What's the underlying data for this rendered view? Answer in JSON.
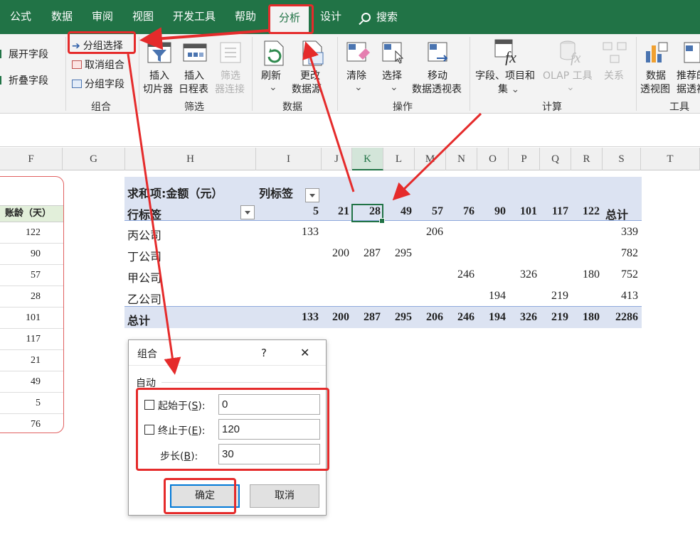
{
  "tabs": [
    {
      "label": "公式"
    },
    {
      "label": "数据"
    },
    {
      "label": "审阅"
    },
    {
      "label": "视图"
    },
    {
      "label": "开发工具"
    },
    {
      "label": "帮助"
    },
    {
      "label": "分析"
    },
    {
      "label": "设计"
    }
  ],
  "search": {
    "label": "搜索"
  },
  "ribbon": {
    "active_field": {
      "expand": "展开字段",
      "collapse": "折叠字段"
    },
    "group": {
      "group_selection": "分组选择",
      "ungroup": "取消组合",
      "group_field": "分组字段",
      "name": "组合"
    },
    "filter": {
      "slicer_1": "插入",
      "slicer_2": "切片器",
      "timeline_1": "插入",
      "timeline_2": "日程表",
      "conn_1": "筛选",
      "conn_2": "器连接",
      "name": "筛选"
    },
    "data": {
      "refresh": "刷新",
      "change_1": "更改",
      "change_2": "数据源",
      "name": "数据"
    },
    "actions": {
      "clear": "清除",
      "select": "选择",
      "move_1": "移动",
      "move_2": "数据透视表",
      "name": "操作"
    },
    "calc": {
      "fields_1": "字段、项目和",
      "fields_2": "集",
      "olap": "OLAP 工具",
      "relations": "关系",
      "name": "计算"
    },
    "tools": {
      "chart_1": "数据",
      "chart_2": "透视图",
      "rec_1": "推荐的",
      "rec_2": "据透视",
      "name": "工具"
    }
  },
  "columns": [
    "F",
    "G",
    "H",
    "I",
    "J",
    "K",
    "L",
    "M",
    "N",
    "O",
    "P",
    "Q",
    "R",
    "S",
    "T"
  ],
  "source_table": {
    "header": "账龄（天）",
    "values": [
      "122",
      "90",
      "57",
      "28",
      "101",
      "117",
      "21",
      "49",
      "5",
      "76"
    ]
  },
  "pivot": {
    "title": "求和项:金额（元）",
    "col_label": "列标签",
    "row_label": "行标签",
    "col_headers": [
      "5",
      "21",
      "28",
      "49",
      "57",
      "76",
      "90",
      "101",
      "117",
      "122"
    ],
    "total_header": "总计",
    "rows": [
      {
        "name": "丙公司",
        "cells": [
          "133",
          "",
          "",
          "",
          "206",
          "",
          "",
          "",
          "",
          ""
        ],
        "total": "339"
      },
      {
        "name": "丁公司",
        "cells": [
          "",
          "200",
          "287",
          "295",
          "",
          "",
          "",
          "",
          "",
          ""
        ],
        "total": "782"
      },
      {
        "name": "甲公司",
        "cells": [
          "",
          "",
          "",
          "",
          "",
          "246",
          "",
          "326",
          "",
          "180"
        ],
        "total": "752"
      },
      {
        "name": "乙公司",
        "cells": [
          "",
          "",
          "",
          "",
          "",
          "",
          "194",
          "",
          "219",
          ""
        ],
        "total": "413"
      }
    ],
    "grand_total": {
      "label": "总计",
      "cells": [
        "133",
        "200",
        "287",
        "295",
        "206",
        "246",
        "194",
        "326",
        "219",
        "180"
      ],
      "total": "2286"
    }
  },
  "dialog": {
    "title": "组合",
    "help": "?",
    "close": "✕",
    "section": "自动",
    "start_label": "起始于(",
    "start_key": "S",
    "start_tail": "):",
    "start_value": "0",
    "end_label": "终止于(",
    "end_key": "E",
    "end_tail": "):",
    "end_value": "120",
    "step_label": "步长(",
    "step_key": "B",
    "step_tail": "):",
    "step_value": "30",
    "ok": "确定",
    "cancel": "取消"
  },
  "colors": {
    "excel_green": "#217346",
    "annotation_red": "#e52b2b",
    "pivot_band": "#dce3f2"
  }
}
